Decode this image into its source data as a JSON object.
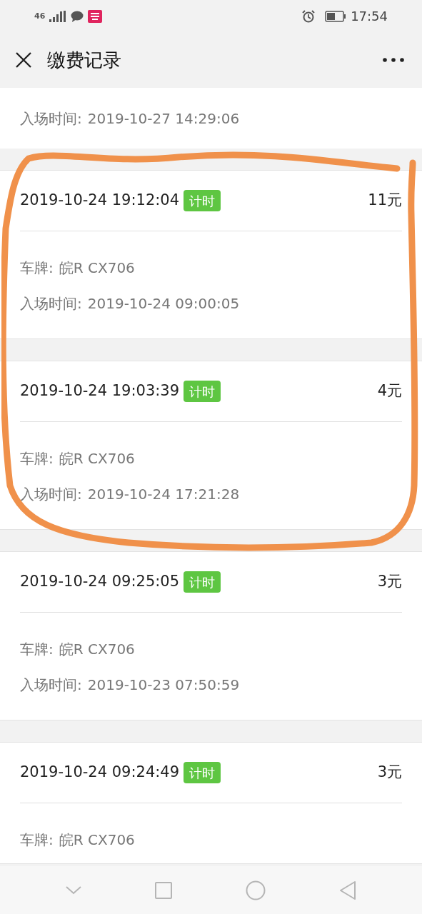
{
  "status_bar": {
    "time": "17:54",
    "network": "46"
  },
  "header": {
    "title": "缴费记录"
  },
  "partial_record": {
    "entry_label": "入场时间:",
    "entry_time": "2019-10-27 14:29:06"
  },
  "records": [
    {
      "paid_time": "2019-10-24 19:12:04",
      "tag": "计时",
      "amount": "11元",
      "plate_label": "车牌:",
      "plate": "皖R CX706",
      "entry_label": "入场时间:",
      "entry_time": "2019-10-24 09:00:05"
    },
    {
      "paid_time": "2019-10-24 19:03:39",
      "tag": "计时",
      "amount": "4元",
      "plate_label": "车牌:",
      "plate": "皖R CX706",
      "entry_label": "入场时间:",
      "entry_time": "2019-10-24 17:21:28"
    },
    {
      "paid_time": "2019-10-24 09:25:05",
      "tag": "计时",
      "amount": "3元",
      "plate_label": "车牌:",
      "plate": "皖R CX706",
      "entry_label": "入场时间:",
      "entry_time": "2019-10-23 07:50:59"
    },
    {
      "paid_time": "2019-10-24 09:24:49",
      "tag": "计时",
      "amount": "3元",
      "plate_label": "车牌:",
      "plate": "皖R CX706"
    }
  ]
}
